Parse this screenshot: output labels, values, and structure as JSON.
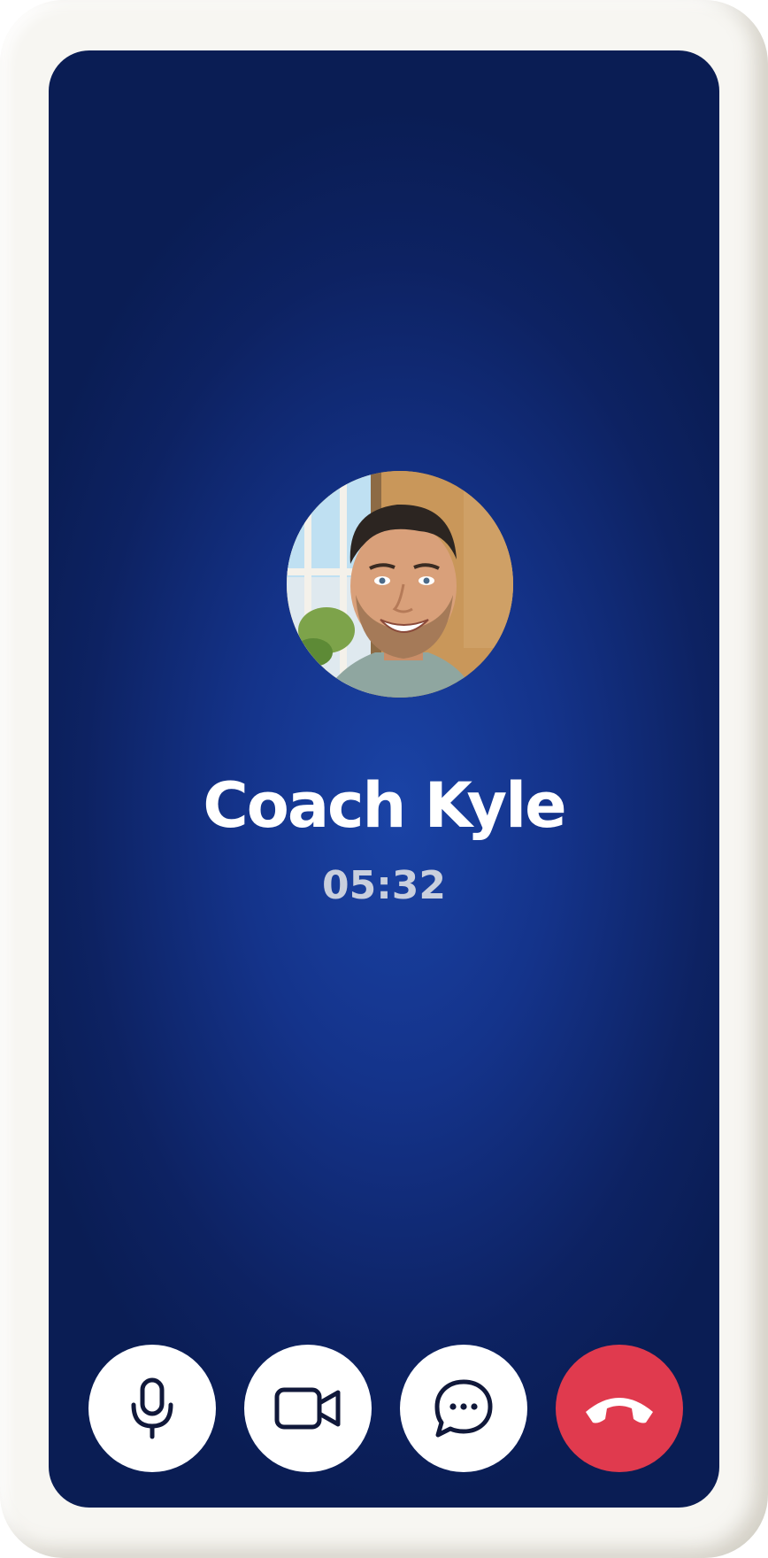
{
  "call": {
    "caller_name": "Coach Kyle",
    "duration": "05:32"
  },
  "controls": [
    {
      "name": "mute",
      "icon": "microphone-icon"
    },
    {
      "name": "video",
      "icon": "video-camera-icon"
    },
    {
      "name": "chat",
      "icon": "chat-bubble-icon"
    },
    {
      "name": "end-call",
      "icon": "phone-hangup-icon"
    }
  ],
  "colors": {
    "background_center": "#1a43a6",
    "background_edge": "#0a1d54",
    "control_bg": "#ffffff",
    "icon": "#10183a",
    "end_call": "#e03a4e"
  }
}
